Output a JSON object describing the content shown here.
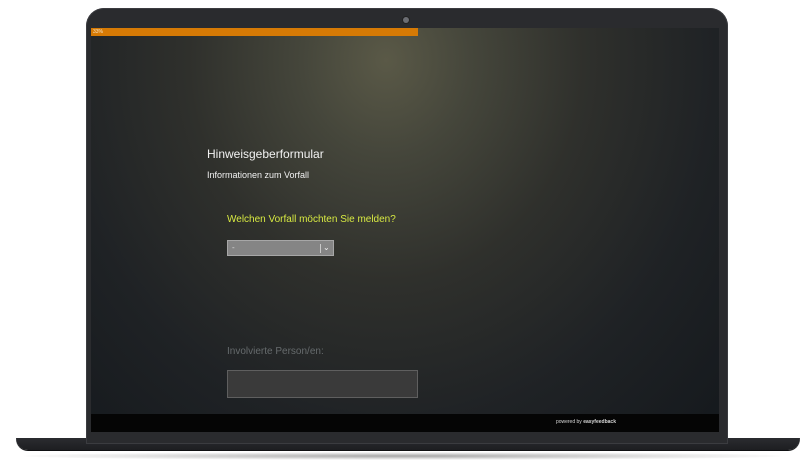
{
  "progress": {
    "label": "33%",
    "value": 0.52,
    "color": "#d67a05"
  },
  "form": {
    "title": "Hinweisgeberformular",
    "section_title": "Informationen zum Vorfall",
    "question_1": {
      "label": "Welchen Vorfall möchten Sie melden?",
      "selected_value": "-",
      "icon": "chevron-down-icon"
    },
    "question_2": {
      "label": "Involvierte Person/en:",
      "value": ""
    }
  },
  "footer": {
    "prefix": "powered by",
    "brand": "easyfeedback"
  },
  "colors": {
    "accent": "#d67a05",
    "question_text": "#d8ea42"
  }
}
